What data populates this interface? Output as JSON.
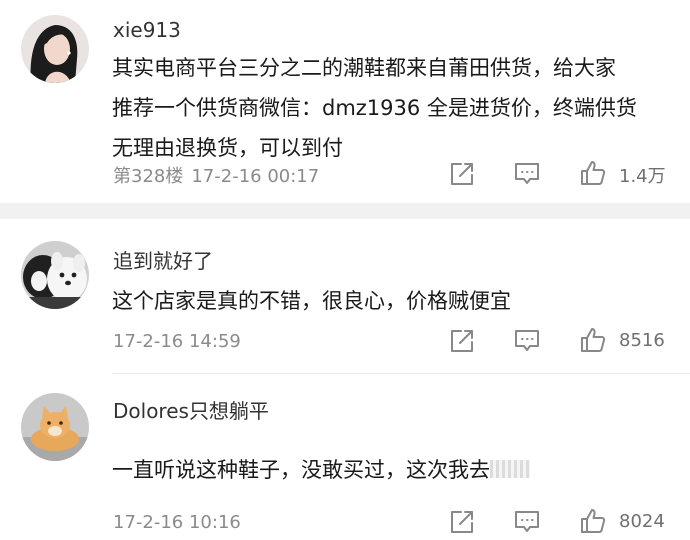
{
  "comments": [
    {
      "username": "xie913",
      "avatar": "woman-portrait-avatar",
      "lines": [
        "其实电商平台三分之二的潮鞋都来自莆田供货，给大家",
        "推荐一个供货商微信：dmz1936 全是进货价，终端供货",
        "无理由退换货，可以到付"
      ],
      "floor": "第328楼",
      "timestamp": "17-2-16 00:17",
      "likes": "1.4万"
    },
    {
      "username": "追到就好了",
      "avatar": "dog-and-cat-avatar",
      "lines": [
        "这个店家是真的不错，很良心，价格贼便宜"
      ],
      "timestamp": "17-2-16 14:59",
      "likes": "8516"
    },
    {
      "username": "Dolores只想躺平",
      "avatar": "orange-cat-avatar",
      "lines": [
        "一直听说这种鞋子，没敢买过，这次我去"
      ],
      "timestamp": "17-2-16 10:16",
      "likes": "8024"
    }
  ],
  "icons": {
    "share": "share-icon",
    "reply": "comment-icon",
    "like": "thumbs-up-icon"
  },
  "colors": {
    "text": "#1a1a1a",
    "username": "#333333",
    "meta": "#8b8b8b",
    "icon": "#888888",
    "separator": "#f1f1f1"
  }
}
